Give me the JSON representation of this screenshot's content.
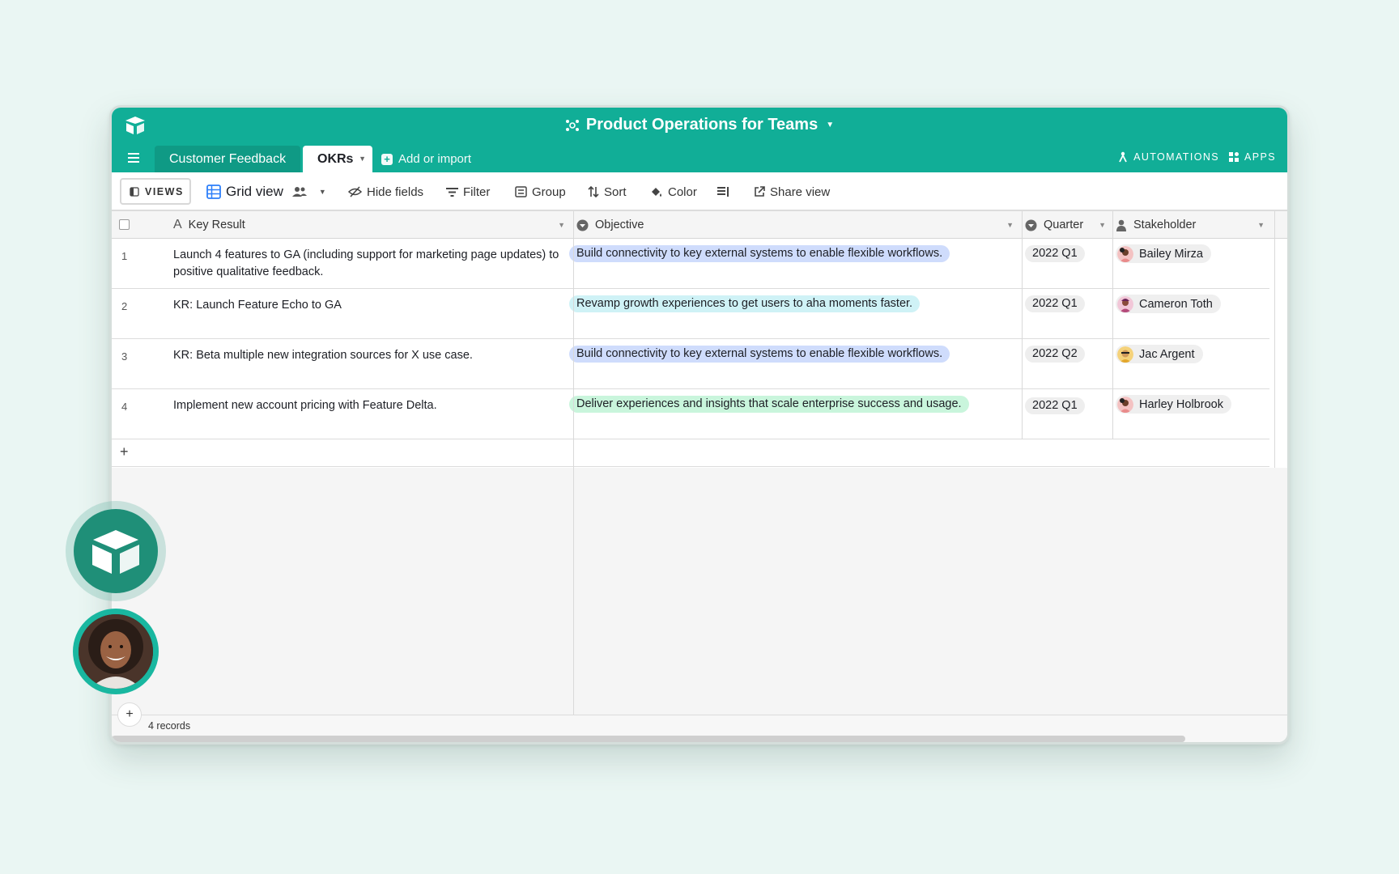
{
  "app": {
    "base_title": "Product Operations for Teams",
    "tabs": [
      {
        "label": "Customer Feedback",
        "active": false
      },
      {
        "label": "OKRs",
        "active": true
      }
    ],
    "add_import": "Add or import",
    "automations": "AUTOMATIONS",
    "apps": "APPS"
  },
  "toolbar": {
    "views": "VIEWS",
    "grid_view": "Grid view",
    "hide_fields": "Hide fields",
    "filter": "Filter",
    "group": "Group",
    "sort": "Sort",
    "color": "Color",
    "share_view": "Share view"
  },
  "columns": {
    "key_result": "Key Result",
    "objective": "Objective",
    "quarter": "Quarter",
    "stakeholder": "Stakeholder"
  },
  "rows": [
    {
      "num": "1",
      "key_result": "Launch 4 features to GA (including support for marketing page updates) to positive qualitative feedback.",
      "objective": "Build connectivity to key external systems to enable flexible workflows.",
      "objective_color": "#cfdcfc",
      "quarter": "2022 Q1",
      "stakeholder": "Bailey Mirza",
      "avatar_color": "#e98b8b"
    },
    {
      "num": "2",
      "key_result": "KR: Launch Feature Echo to GA",
      "objective": "Revamp growth experiences to get users to aha moments faster.",
      "objective_color": "#cff2f6",
      "quarter": "2022 Q1",
      "stakeholder": "Cameron Toth",
      "avatar_color": "#b44a7a"
    },
    {
      "num": "3",
      "key_result": "KR: Beta multiple new integration sources for X use case.",
      "objective": "Build connectivity to key external systems to enable flexible workflows.",
      "objective_color": "#cfdcfc",
      "quarter": "2022 Q2",
      "stakeholder": "Jac Argent",
      "avatar_color": "#e3a72b"
    },
    {
      "num": "4",
      "key_result": "Implement new account pricing with Feature Delta.",
      "objective": "Deliver experiences and insights that scale enterprise success and usage.",
      "objective_color": "#c9f5dc",
      "quarter": "2022 Q1",
      "stakeholder": "Harley Holbrook",
      "avatar_color": "#e98b8b"
    }
  ],
  "footer": {
    "records": "4 records"
  }
}
